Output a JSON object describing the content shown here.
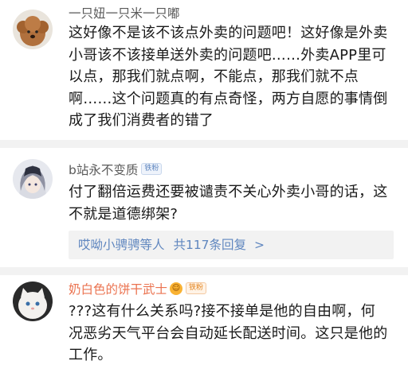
{
  "comments": [
    {
      "username": "一只妞一只米一只嘟",
      "badge": "",
      "text_lines": [
        "这好像不是该不该点外卖的问题吧！这好像是外卖",
        "小哥该不该接单送外卖的问题吧……外卖APP里可",
        "以点，那我们就点啊，不能点，那我们就不点",
        "啊……这个问题真的有点奇怪，两方自愿的事情倒",
        "成了我们消费者的错了"
      ]
    },
    {
      "username": "b站永不变质",
      "badge": "铁粉",
      "text_lines": [
        "付了翻倍运费还要被谴责不关心外卖小哥的话，这",
        "不就是道德绑架?"
      ],
      "replies": {
        "who": "哎呦小骋骋等人",
        "count_text": "共117条回复",
        "arrow": ">"
      }
    },
    {
      "username": "奶白色的饼干武士",
      "badge": "铁粉",
      "text_lines": [
        "???这有什么关系吗?接不接单是他的自由啊，何",
        "况恶劣天气平台会自动延长配送时间。这只是他的",
        "工作。"
      ]
    }
  ],
  "colors": {
    "username_default": "#5a5a5a",
    "username_vip": "#eb7350",
    "link_blue": "#5f86bf",
    "divider_gray": "#f2f2f2"
  }
}
